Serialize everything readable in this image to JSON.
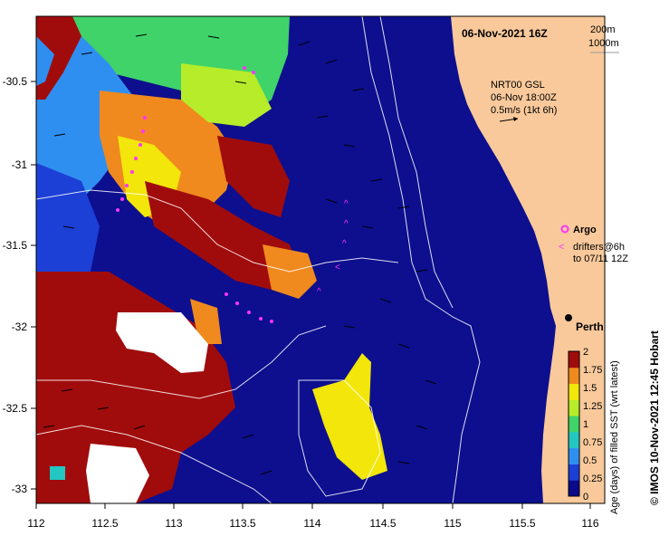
{
  "header": {
    "date_label": "06-Nov-2021 16Z",
    "contour_label_1": "200m",
    "contour_label_2": "1000m"
  },
  "current_info": {
    "line1": "NRT00 GSL",
    "line2": "06-Nov 18:00Z",
    "line3": "0.5m/s (1kt 6h)"
  },
  "legend": {
    "argo_label": "Argo",
    "drifters_line1": "drifters@6h",
    "drifters_line2": "to 07/11 12Z"
  },
  "place": {
    "city": "Perth"
  },
  "colorbar": {
    "title": "Age (days) of filled SST (wrt latest)",
    "ticks": [
      "0",
      "0.25",
      "0.5",
      "0.75",
      "1",
      "1.25",
      "1.5",
      "1.75",
      "2"
    ],
    "colors": [
      "#0a0a8a",
      "#1c3fd6",
      "#2f8ff0",
      "#22c7c2",
      "#3fd36a",
      "#b6ec2a",
      "#f2e60a",
      "#f08a1e",
      "#a00c0c"
    ]
  },
  "axes": {
    "x_ticks": [
      "112",
      "112.5",
      "113",
      "113.5",
      "114",
      "114.5",
      "115",
      "115.5",
      "116"
    ],
    "y_ticks": [
      "-30.5",
      "-31",
      "-31.5",
      "-32",
      "-32.5",
      "-33"
    ]
  },
  "credit": "© IMOS 10-Nov-2021 12:45 Hobart",
  "colors": {
    "land": "#f9c99b",
    "ocean_deep": "#0d0f8e",
    "drifter": "#ff33ff"
  }
}
